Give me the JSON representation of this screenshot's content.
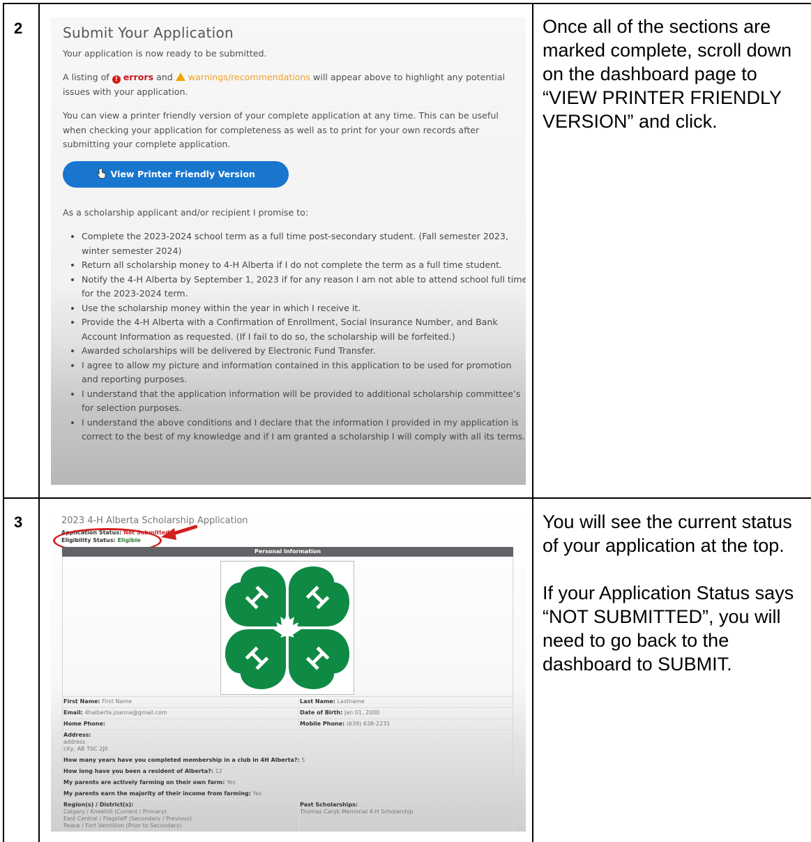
{
  "rows": [
    {
      "step": "2",
      "description": [
        "Once all of the sections are marked complete, scroll down on the dashboard page to “VIEW PRINTER FRIENDLY VERSION” and click."
      ],
      "screenshot": {
        "title": "Submit Your Application",
        "ready_text": "Your application is now ready to be submitted.",
        "listing_prefix": "A listing of",
        "errors_word": "errors",
        "and_word": "and",
        "warnings_word": "warnings/recommendations",
        "listing_suffix": "will appear above to highlight any potential issues with your application.",
        "printer_text": "You can view a printer friendly version of your complete application at any time. This can be useful when checking your application for completeness as well as to print for your own records after submitting your complete application.",
        "button_label": "View Printer Friendly Version",
        "promise_intro": "As a scholarship applicant and/or recipient I promise to:",
        "promises": [
          "Complete the 2023-2024 school term as a full time post-secondary student. (Fall semester 2023, winter semester 2024)",
          "Return all scholarship money to 4-H Alberta if I do not complete the term as a full time student.",
          "Notify the 4-H Alberta by September 1, 2023 if for any reason I am not able to attend school full time for the 2023-2024 term.",
          "Use the scholarship money within the year in which I receive it.",
          "Provide the 4-H Alberta with a Confirmation of Enrollment, Social Insurance Number, and Bank Account Information as requested. (If I fail to do so, the scholarship will be forfeited.)",
          "Awarded scholarships will be delivered by Electronic Fund Transfer.",
          "I agree to allow my picture and information contained in this application to be used for promotion and reporting purposes.",
          "I understand that the application information will be provided to additional scholarship committee’s for selection purposes.",
          "I understand the above conditions and I declare that the information I provided in my application is correct to the best of my knowledge and if I am granted a scholarship I will comply with all its terms."
        ]
      }
    },
    {
      "step": "3",
      "description": [
        "You will see the current status of your application at the top.",
        "If your Application Status says “NOT SUBMITTED”, you will need to go back to the dashboard to SUBMIT."
      ],
      "screenshot": {
        "title": "2023 4-H Alberta Scholarship Application",
        "app_status_label": "Application Status:",
        "app_status_value": "Not Submitted",
        "elig_status_label": "Eligibility Status:",
        "elig_status_value": "Eligible",
        "section_header": "Personal Information",
        "fields": {
          "first_name_label": "First Name:",
          "first_name": "First Name",
          "last_name_label": "Last Name:",
          "last_name": "Lastname",
          "email_label": "Email:",
          "email": "4halberta.joanna@gmail.com",
          "dob_label": "Date of Birth:",
          "dob": "Jan 01, 2000",
          "home_phone_label": "Home Phone:",
          "home_phone": "",
          "mobile_phone_label": "Mobile Phone:",
          "mobile_phone": "(639) 638-2231",
          "address_label": "Address:",
          "address_line1": "address",
          "address_line2": "city, AB T0C 2J0",
          "q_years_label": "How many years have you completed membership in a club in 4H Alberta?:",
          "q_years": "5",
          "q_resident_label": "How long have you been a resident of Alberta?:",
          "q_resident": "12",
          "q_farming_label": "My parents are actively farming on their own farm:",
          "q_farming": "Yes",
          "q_income_label": "My parents earn the majority of their income from farming:",
          "q_income": "Yes",
          "regions_label": "Region(s) / District(s):",
          "regions": [
            "Calgary / Kneehill (Current / Primary)",
            "East Central / Flagstaff (Secondary / Previous)",
            "Peace / Fort Vermilion (Prior to Secondary)"
          ],
          "past_label": "Past Scholarships:",
          "past": "Thomas Caryk Memorial 4-H Scholarship"
        }
      }
    }
  ],
  "colors": {
    "button_blue": "#1976cf",
    "error_red": "#c8171c",
    "warning_orange": "#f0a22a",
    "logo_green": "#0f8a45",
    "annotation_red": "#d32020"
  },
  "icons": {
    "error": "exclamation-circle-icon",
    "warning": "warning-triangle-icon",
    "cursor": "hand-cursor-icon",
    "logo": "four-h-clover-logo",
    "arrow": "red-arrow-icon"
  }
}
